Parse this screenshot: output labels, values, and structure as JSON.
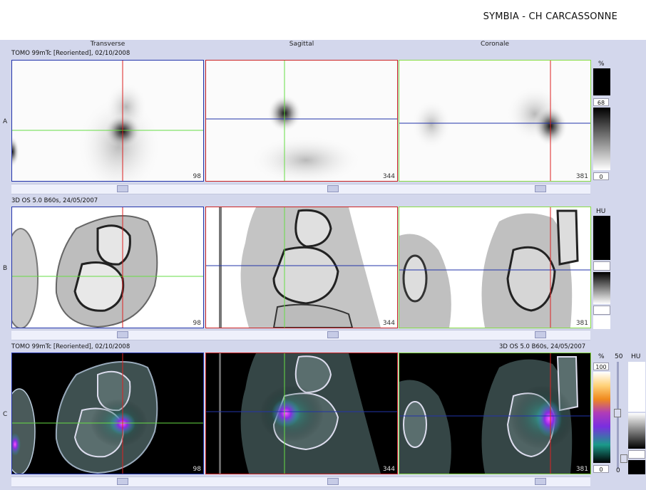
{
  "app": {
    "title": "SYMBIA - CH CARCASSONNE"
  },
  "columns": [
    {
      "label": "Transverse"
    },
    {
      "label": "Sagittal"
    },
    {
      "label": "Coronale"
    }
  ],
  "rows": {
    "A": {
      "letter": "A",
      "info": "TOMO 99mTc [Reoriented], 02/10/2008",
      "slices": [
        "98",
        "344",
        "381"
      ]
    },
    "B": {
      "letter": "B",
      "info": "3D  OS  5.0  B60s, 24/05/2007",
      "slices": [
        "98",
        "344",
        "381"
      ]
    },
    "C": {
      "letter": "C",
      "info": "TOMO 99mTc [Reoriented], 02/10/2008",
      "info_right": "3D  OS  5.0  B60s, 24/05/2007",
      "slices": [
        "98",
        "344",
        "381"
      ]
    }
  },
  "colorbars": {
    "A": {
      "unit": "%",
      "max": "68",
      "min": "0"
    },
    "B": {
      "unit": "HU"
    },
    "C": {
      "unit": "%",
      "max": "100",
      "min": "0",
      "blend_label": "50",
      "unit2": "HU",
      "blend_min": "0"
    }
  },
  "colors": {
    "transverse_border": "#2233aa",
    "sagittal_border": "#cc2222",
    "coronal_border": "#88dd44",
    "workspace": "#d3d7ec"
  }
}
